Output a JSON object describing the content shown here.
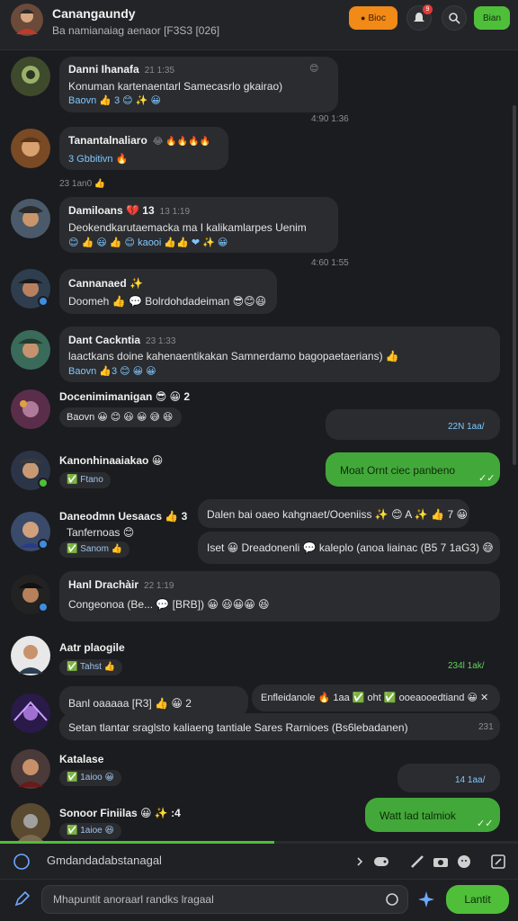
{
  "header": {
    "title": "Canangaundy",
    "subtitle": "Ba namianaiag aenaor [F3S3 [026]",
    "live_label": "Bioc",
    "notification_count": "9",
    "join_label": "Bian"
  },
  "messages": [
    {
      "name": "Danni Ihanafa",
      "time": "21 1:35",
      "text": "Konuman kartenaentarl Samecasrlo gkairao)",
      "reacts": "Baovn 👍 3 😊 ✨ 😀",
      "meta": "4:90 1:36",
      "side_meta": "😊"
    },
    {
      "name": "Tanantalnaliaro",
      "time": "😂 🔥🔥🔥🔥",
      "text": "",
      "reacts": "3 Gbbitivn 🔥",
      "meta": "",
      "below": "23 1an0 👍"
    },
    {
      "name": "Damiloans 💔 13",
      "time": "13 1:19",
      "text": "Deokendkarutaemacka ma I kalikamlarpes Uenim",
      "reacts": "😊 👍 😃 👍 😊 kaooi 👍👍 ❤ ✨ 😀",
      "meta": "4:60 1:55"
    },
    {
      "name": "Cannanaed ✨",
      "time": "",
      "text": "Doomeh 👍 💬 Bolrdohdadeiman 😎😊😃",
      "reacts": "",
      "meta": ""
    },
    {
      "name": "Dant Cackntia",
      "time": "23 1:33",
      "text": "laactkans doine kahenaentikakan Samnerdamo bagopaetaerians) 👍",
      "reacts": "Baovn 👍3 😊 😀 😀",
      "meta": ""
    },
    {
      "name": "Docenimimanigan 😎 😀 2",
      "time": "",
      "text": "",
      "reacts": "Baovn 😀 😊 😃 😀 😅 😆",
      "meta": ""
    },
    {
      "name": "Kanonhinaaiakao 😀",
      "time": "",
      "text": "",
      "reacts": "",
      "chip": "✅ Ftano",
      "meta": ""
    },
    {
      "name": "Daneodmn Uesaacs 👍 3",
      "time": "",
      "text": "Tanfernoas 😊",
      "reacts": "",
      "chip": "✅ Sanom 👍",
      "meta": ""
    },
    {
      "name": "Hanl Drachàir",
      "time": "22 1:19",
      "text": "Congeonoa (Be... 💬 [BRB]) 😀 😃😀😀 😆",
      "reacts": "",
      "meta": ""
    },
    {
      "name": "Aatr plaogile",
      "time": "",
      "text": "",
      "reacts": "",
      "chip": "✅ Tahst 👍",
      "meta": "",
      "right_meta": "234l 1ak/"
    },
    {
      "name": "Banl",
      "time": "",
      "text": "Banl oaaaaa [R3] 👍 😀 2",
      "reacts": "",
      "meta": ""
    },
    {
      "name": "Katalase",
      "time": "",
      "text": "",
      "reacts": "",
      "chip": "✅ 1aioo 😀",
      "meta": ""
    },
    {
      "name": "Sonoor Finiilas 😀 ✨ :4",
      "time": "",
      "text": "",
      "reacts": "",
      "chip": "✅ 1aioe 😆",
      "meta": ""
    }
  ],
  "outgoing": [
    {
      "text": "",
      "meta": "22N 1aa/"
    },
    {
      "text": "Moat Ornt ciec panbeno",
      "meta": "✓✓"
    },
    {
      "text": "Dalen bai oaeo kahgnaet/Ooeniiss ✨ 😊 A ✨ 👍 7 😀",
      "meta": ""
    },
    {
      "text": "Iset 😀 Dreadonenli 💬 kaleplo (anoa liainac (B5 7 1aG3) 😅",
      "highlight": "Dreadonenli",
      "meta": ""
    },
    {
      "text": "Enfleidanole 🔥 1aa ✅ oht ✅ ooeaooedtiand 😀 ✕",
      "meta": ""
    },
    {
      "text": "Setan tlantar sraglsto kaliaeng tantiale Sares Rarnioes (Bs6lebadanen)",
      "meta": "231"
    },
    {
      "text": "",
      "meta": "14 1aa/"
    },
    {
      "text": "Watt lad talmiok",
      "meta": "✓✓"
    }
  ],
  "composer": {
    "thread_label": "Gmdandadabstanagal",
    "placeholder": "Mhapuntit anoraarl randks lragaal",
    "send_label": "Lantit",
    "progress": 0.53
  },
  "colors": {
    "accent_green": "#4fbf3a",
    "accent_orange": "#f18a16",
    "background": "#1b1c1f",
    "bubble": "#2b2c30"
  }
}
